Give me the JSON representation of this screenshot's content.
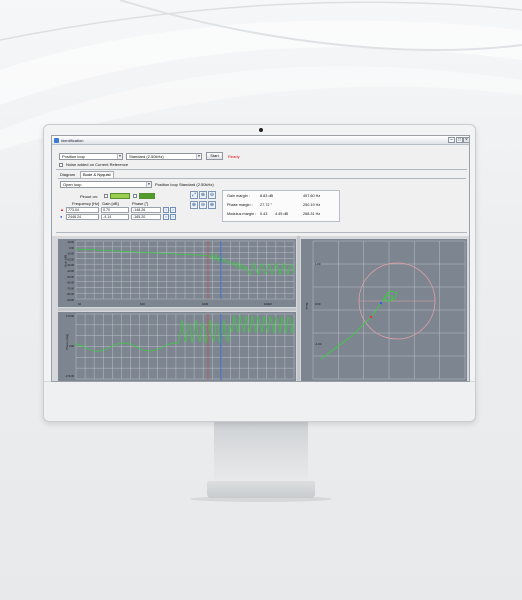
{
  "window": {
    "title": "Identification",
    "minimize": "–",
    "maximize": "□",
    "close": "×"
  },
  "toolbar": {
    "loop_select": "Position loop",
    "standard_select": "Standard (2.50kHz)",
    "start_label": "Start",
    "status": "Ready",
    "noise_checkbox_label": "Noise added on Current Reference"
  },
  "diagram": {
    "label": "Diagram",
    "tab": "Bode & Nyquist",
    "mode_select": "Open loop",
    "mode_description": "Position loop  Standard (2.50kHz)"
  },
  "pinout": {
    "label": "Pinout on:",
    "option1": "",
    "option2": ""
  },
  "freq_table": {
    "headers": [
      "Frequency [Hz]",
      "Gain [dB]",
      "Phase [°]"
    ],
    "rows": [
      {
        "marker": "▲",
        "freq": "773.04",
        "gain": "0.70",
        "phase": "-148.26"
      },
      {
        "marker": "●",
        "freq": "2448.24",
        "gain": "-4.14",
        "phase": "-165.20"
      }
    ]
  },
  "tools": [
    "⤢",
    "⊕",
    "⊖",
    "⊕",
    "⊖",
    "⊕"
  ],
  "margins": [
    {
      "label": "Gain margin :",
      "value": "8.83 dB",
      "freq": "457.60 Hz"
    },
    {
      "label": "Phase margin :",
      "value": "27.72 °",
      "freq": "250.19 Hz"
    },
    {
      "label": "Modulus margin :",
      "value": "0.43",
      "db": "4.49 dB",
      "freq": "268.31 Hz"
    }
  ],
  "bode_gain": {
    "ylabel": "Gain [dB]",
    "yticks": [
      "10.00",
      "0.00",
      "-10.00",
      "-20.00",
      "-30.00",
      "-40.00",
      "-50.00",
      "-60.00",
      "-70.00",
      "-80.00",
      "-90.00"
    ],
    "xticks": [
      "10",
      "100",
      "1000",
      "10000"
    ]
  },
  "bode_phase": {
    "ylabel": "Phase [deg]",
    "yticks": [
      "170.00",
      "0.00",
      "-170.00"
    ]
  },
  "nyquist": {
    "ylabel": "Imag",
    "yticks": [
      "1.00",
      "0.00",
      "-1.00"
    ]
  },
  "colors": {
    "trace": "#35d13a",
    "circle": "#e6a3a8",
    "marker_red": "#e23b3b",
    "marker_blue": "#2d5fe0",
    "plot_bg": "#7d8591",
    "grid": "#c9cdd3"
  }
}
